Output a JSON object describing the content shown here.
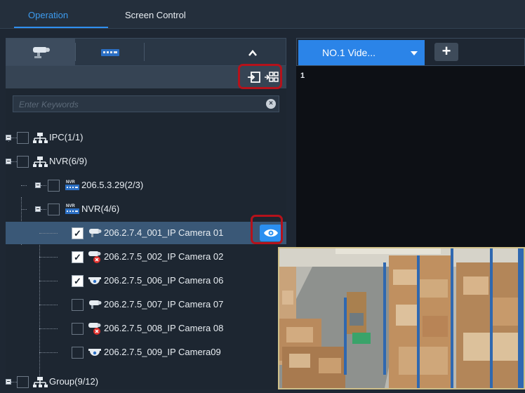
{
  "top_tabs": [
    {
      "label": "Operation",
      "active": true
    },
    {
      "label": "Screen Control",
      "active": false
    }
  ],
  "device_tabs": [
    {
      "icon": "ipc-camera-icon",
      "active": true
    },
    {
      "icon": "nvr-device-icon",
      "active": false
    }
  ],
  "collapse_icon": "chevron-up-icon",
  "action_icons": [
    "import-icon",
    "batch-import-icon"
  ],
  "search": {
    "placeholder": "Enter Keywords",
    "value": ""
  },
  "tree": [
    {
      "label": "IPC(1/1)",
      "icon": "network-group-icon",
      "checked": false,
      "level": 0
    },
    {
      "label": "NVR(6/9)",
      "icon": "network-group-icon",
      "checked": false,
      "level": 0
    },
    {
      "label": "206.5.3.29(2/3)",
      "icon": "nvr-device-icon",
      "checked": false,
      "level": 1
    },
    {
      "label": "NVR(4/6)",
      "icon": "nvr-device-icon",
      "checked": false,
      "level": 1
    },
    {
      "label": "206.2.7.4_001_IP Camera 01",
      "icon": "bullet-camera-icon",
      "checked": true,
      "level": 2,
      "selected": true
    },
    {
      "label": "206.2.7.5_002_IP Camera 02",
      "icon": "bullet-camera-offline-icon",
      "checked": true,
      "level": 2
    },
    {
      "label": "206.2.7.5_006_IP Camera 06",
      "icon": "dome-camera-icon",
      "checked": true,
      "level": 2
    },
    {
      "label": "206.2.7.5_007_IP Camera 07",
      "icon": "bullet-camera-icon",
      "checked": false,
      "level": 2
    },
    {
      "label": "206.2.7.5_008_IP Camera 08",
      "icon": "bullet-camera-offline-icon",
      "checked": false,
      "level": 2
    },
    {
      "label": "206.2.7.5_009_IP Camera09",
      "icon": "dome-camera-icon",
      "checked": false,
      "level": 2
    },
    {
      "label": "Group(9/12)",
      "icon": "network-group-icon",
      "checked": false,
      "level": 0
    }
  ],
  "video_wall": {
    "tab_label": "NO.1 Vide...",
    "add_label": "+",
    "window_number": "1"
  },
  "colors": {
    "accent": "#2b84e8",
    "highlight_box": "#b5121b",
    "selected_row": "#3a5877",
    "offline": "#e0302c"
  }
}
